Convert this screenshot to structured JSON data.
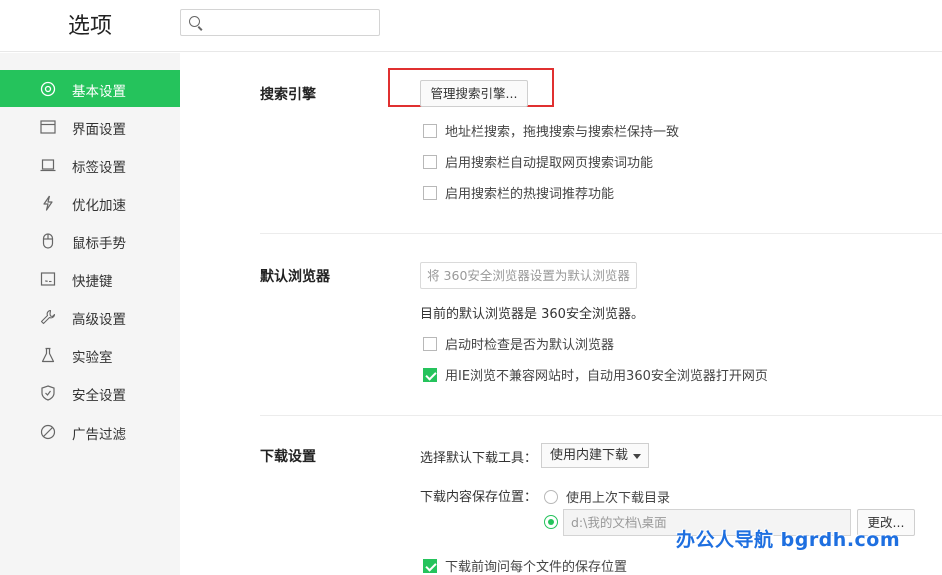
{
  "header": {
    "title": "选项",
    "search_value": ""
  },
  "sidebar": {
    "items": [
      {
        "label": "基本设置",
        "icon": "gear-icon",
        "active": true
      },
      {
        "label": "界面设置",
        "icon": "window-icon",
        "active": false
      },
      {
        "label": "标签设置",
        "icon": "tab-icon",
        "active": false
      },
      {
        "label": "优化加速",
        "icon": "lightning-icon",
        "active": false
      },
      {
        "label": "鼠标手势",
        "icon": "mouse-icon",
        "active": false
      },
      {
        "label": "快捷键",
        "icon": "keyboard-icon",
        "active": false
      },
      {
        "label": "高级设置",
        "icon": "wrench-icon",
        "active": false
      },
      {
        "label": "实验室",
        "icon": "flask-icon",
        "active": false
      },
      {
        "label": "安全设置",
        "icon": "shield-icon",
        "active": false
      },
      {
        "label": "广告过滤",
        "icon": "block-icon",
        "active": false
      }
    ]
  },
  "search_engine": {
    "title": "搜索引擎",
    "manage_label": "管理搜索引擎...",
    "options": [
      {
        "label": "地址栏搜索，拖拽搜索与搜索栏保持一致",
        "checked": false
      },
      {
        "label": "启用搜索栏自动提取网页搜索词功能",
        "checked": false
      },
      {
        "label": "启用搜索栏的热搜词推荐功能",
        "checked": false
      }
    ]
  },
  "default_browser": {
    "title": "默认浏览器",
    "set_default_label": "将 360安全浏览器设置为默认浏览器",
    "status_text": "目前的默认浏览器是 360安全浏览器。",
    "options": [
      {
        "label": "启动时检查是否为默认浏览器",
        "checked": false
      },
      {
        "label": "用IE浏览不兼容网站时，自动用360安全浏览器打开网页",
        "checked": true
      }
    ]
  },
  "download": {
    "title": "下载设置",
    "tool_label": "选择默认下载工具：",
    "tool_value": "使用内建下载",
    "save_label": "下载内容保存位置：",
    "radio_last": "使用上次下载目录",
    "path_value": "d:\\我的文档\\桌面",
    "change_label": "更改...",
    "ask_label": "下载前询问每个文件的保存位置",
    "ask_checked": true
  },
  "watermark": "办公人导航  bgrdh.com",
  "colors": {
    "accent": "#25c35c",
    "highlight": "#e03030"
  }
}
